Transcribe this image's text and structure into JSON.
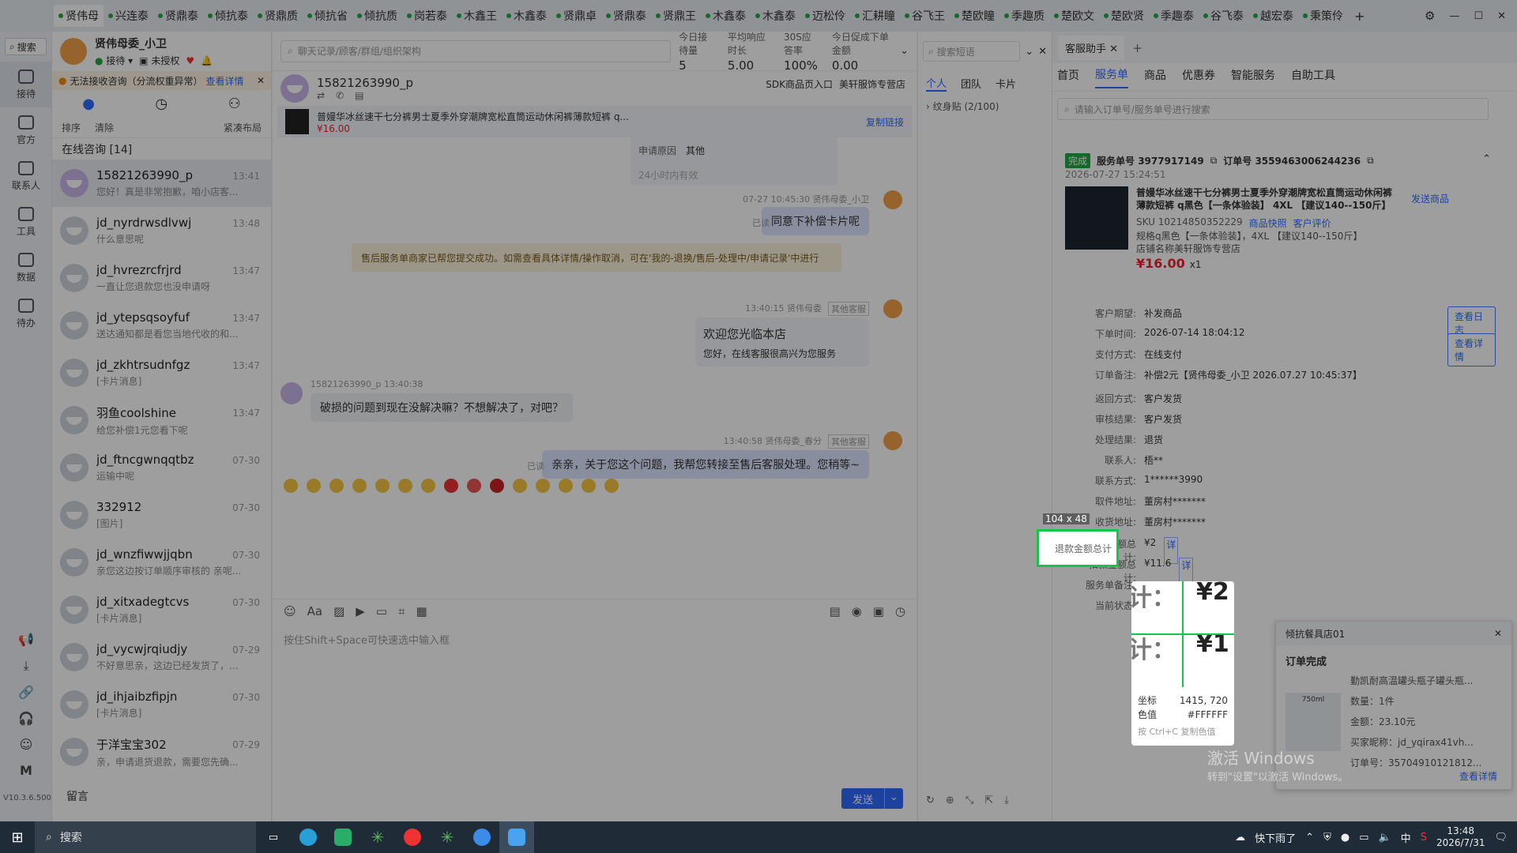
{
  "top_tabs": [
    "贤伟母",
    "兴连泰",
    "贤鼎泰",
    "倾抗泰",
    "贤鼎质",
    "倾抗省",
    "倾抗质",
    "岗若泰",
    "木鑫王",
    "木鑫泰",
    "贤鼎卓",
    "贤鼎泰",
    "贤鼎王",
    "木鑫泰",
    "木鑫泰",
    "迈松伶",
    "汇耕瞳",
    "谷飞王",
    "楚欧瞳",
    "季趣质",
    "楚欧文",
    "楚欧贤",
    "季趣泰",
    "谷飞泰",
    "越宏泰",
    "秉策伶"
  ],
  "search_label": "搜索",
  "rail": [
    {
      "label": "接待",
      "icon": "chat-icon"
    },
    {
      "label": "官方",
      "icon": "message-icon"
    },
    {
      "label": "联系人",
      "icon": "contact-icon"
    },
    {
      "label": "工具",
      "icon": "tools-icon"
    },
    {
      "label": "数据",
      "icon": "data-icon"
    },
    {
      "label": "待办",
      "icon": "todo-icon"
    }
  ],
  "version": "V10.3.6.500",
  "agent": {
    "name": "贤伟母委_小卫",
    "status": "接待",
    "auth": "未授权"
  },
  "warning": {
    "text": "无法接收咨询（分流权重异常）",
    "link": "查看详情"
  },
  "list_tools": {
    "sort": "排序",
    "clear": "清除",
    "layout": "紧凑布局"
  },
  "group": {
    "title": "在线咨询 [14]"
  },
  "conversations": [
    {
      "name": "15821263990_p",
      "preview": "您好！真是非常抱歉，咱小店客...",
      "time": "13:41",
      "sel": true
    },
    {
      "name": "jd_nyrdrwsdlvwj",
      "preview": "什么意思呢",
      "time": "13:48"
    },
    {
      "name": "jd_hvrezrcfrjrd",
      "preview": "一直让您退款您也没申请呀",
      "time": "13:47"
    },
    {
      "name": "jd_ytepsqsoyfuf",
      "preview": "送达通知都是看您当地代收的和...",
      "time": "13:47"
    },
    {
      "name": "jd_zkhtrsudnfgz",
      "preview": "[卡片消息]",
      "time": "13:47"
    },
    {
      "name": "羽鱼coolshine",
      "preview": "给您补偿1元您看下呢",
      "time": "13:47"
    },
    {
      "name": "jd_ftncgwnqqtbz",
      "preview": "运输中呢",
      "time": "07-30"
    },
    {
      "name": "332912",
      "preview": "[图片]",
      "time": "07-30"
    },
    {
      "name": "jd_wnzfiwwjjqbn",
      "preview": "亲您这边按订单顺序审核的 亲呢...",
      "time": "07-30"
    },
    {
      "name": "jd_xitxadegtcvs",
      "preview": "[卡片消息]",
      "time": "07-30"
    },
    {
      "name": "jd_vycwjrqiudjy",
      "preview": "不好意思亲，这边已经发货了，...",
      "time": "07-29"
    },
    {
      "name": "jd_ihjaibzfipjn",
      "preview": "[卡片消息]",
      "time": "07-30"
    },
    {
      "name": "于洋宝宝302",
      "preview": "亲，申请退货退款，需要您先确...",
      "time": "07-29"
    }
  ],
  "leave_msg": "留言",
  "chat": {
    "search_placeholder": "聊天记录/顾客/群组/组织架构",
    "stats": [
      {
        "k": "今日接待量",
        "v": "5"
      },
      {
        "k": "平均响应时长",
        "v": "5.00"
      },
      {
        "k": "30S应答率",
        "v": "100%"
      },
      {
        "k": "今日促成下单金额",
        "v": "0.00"
      }
    ],
    "customer": "15821263990_p",
    "sdk": "SDK商品页入口",
    "shop": "美轩服饰专营店",
    "product_title": "普嫚华冰丝速干七分裤男士夏季外穿潮牌宽松直筒运动休闲裤薄款短裤 q...",
    "product_price": "¥16.00",
    "copy_link": "复制链接",
    "reason_label": "申请原因",
    "reason_value": "其他",
    "hint24": "24小时内有效",
    "msg1_meta": "07-27 10:45:30  贤伟母委_小卫",
    "msg1": "同意下补偿卡片呢",
    "read1": "已读",
    "notice": "售后服务单商家已帮您提交成功。如需查看具体详情/操作取消，可在'我的-退换/售后-处理中/申请记录'中进行",
    "msg2_meta": "13:40:15  贤伟母委",
    "msg2_tag": "其他客服",
    "welcome_title": "欢迎您光临本店",
    "welcome_sub": "您好，在线客服很高兴为您服务",
    "cust_meta": "15821263990_p  13:40:38",
    "cust_msg": "破损的问题到现在没解决嘛？不想解决了，对吧？",
    "msg3_meta": "13:40:58  贤伟母委_春分",
    "msg3_tag": "其他客服",
    "read3": "已读",
    "msg3": "亲亲，关于您这个问题，我帮您转接至售后客服处理。您稍等~",
    "input_placeholder": "按住Shift+Space可快速选中输入框",
    "send": "发送"
  },
  "quick": {
    "search_placeholder": "搜索短语",
    "tabs": [
      "个人",
      "团队",
      "卡片"
    ],
    "group": "纹身贴 (2/100)"
  },
  "assistant": {
    "tab": "客服助手",
    "subtabs": [
      "首页",
      "服务单",
      "商品",
      "优惠券",
      "智能服务",
      "自助工具"
    ],
    "search_placeholder": "请输入订单号/服务单号进行搜索",
    "status": "完成",
    "service_no": "服务单号 3977917149",
    "order_no": "订单号 3559463006244236",
    "created": "2026-07-27 15:24:51",
    "product": "普嫚华冰丝速干七分裤男士夏季外穿潮牌宽松直筒运动休闲裤薄款短裤 q黑色【一条体验装】 4XL 【建议140--150斤】",
    "send_product": "发送商品",
    "sku": "SKU 10214850352229",
    "snapshot": "商品快照",
    "review": "客户评价",
    "spec": "规格q黑色【一条体验装】，4XL 【建议140--150斤】",
    "store": "店铺名称美轩服饰专营店",
    "price": "¥16.00",
    "qty": "x1",
    "view_log": "查看日志",
    "view_detail": "查看详情",
    "fields": [
      {
        "k": "客户期望:",
        "v": "补发商品"
      },
      {
        "k": "下单时间:",
        "v": "2026-07-14 18:04:12"
      },
      {
        "k": "支付方式:",
        "v": "在线支付"
      },
      {
        "k": "订单备注:",
        "v": "补偿2元【贤伟母委_小卫 2026.07.27 10:45:37】"
      },
      {
        "k": "返回方式:",
        "v": "客户发货"
      },
      {
        "k": "审核结果:",
        "v": "客户发货"
      },
      {
        "k": "处理结果:",
        "v": "退货"
      },
      {
        "k": "联系人:",
        "v": "梧**"
      },
      {
        "k": "联系方式:",
        "v": "1******3990"
      },
      {
        "k": "取件地址:",
        "v": "董房村*******"
      },
      {
        "k": "收货地址:",
        "v": "董房村*******"
      },
      {
        "k": "退款金额总计:",
        "v": "¥2"
      },
      {
        "k": "扣款金额总计:",
        "v": "¥11.6"
      },
      {
        "k": "服务单备注:",
        "v": ""
      },
      {
        "k": "当前状态:",
        "v": "完成"
      }
    ],
    "detail_tag": "详"
  },
  "picker": {
    "size": "104 x 48",
    "sel_text": "退款金额总计",
    "coord_label": "坐标",
    "coord": "1415, 720",
    "color_label": "色值",
    "color": "#FFFFFF",
    "hint": "按 Ctrl+C 复制色值",
    "zoom_text": [
      "计：",
      "¥2",
      "计：",
      "¥1"
    ]
  },
  "notif": {
    "title": "倾抗餐具店01",
    "status": "订单完成",
    "product": "勤凯耐高温罐头瓶子罐头瓶...",
    "qty": "数量：1件",
    "amount": "金额：23.10元",
    "buyer": "买家昵称：jd_yqirax41vh...",
    "order": "订单号：35704910121812...",
    "view": "查看详情",
    "bottle": "750ml"
  },
  "watermark": {
    "line1": "激活 Windows",
    "line2": "转到\"设置\"以激活 Windows。"
  },
  "taskbar": {
    "search": "搜索",
    "weather": "快下雨了",
    "ime": "中",
    "time": "13:48",
    "date": "2026/7/31"
  },
  "colors": {
    "accent": "#2f6bff",
    "green": "#28a745",
    "picker": "#19c24a"
  }
}
